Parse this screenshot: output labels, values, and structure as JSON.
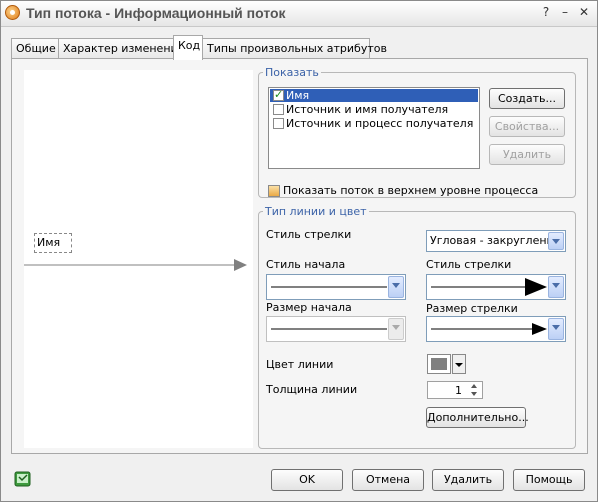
{
  "window": {
    "title": "Тип потока - Информационный поток"
  },
  "tabs": [
    {
      "label": "Общие"
    },
    {
      "label": "Характер изменения"
    },
    {
      "label": "Код"
    },
    {
      "label": "Типы произвольных атрибутов"
    }
  ],
  "preview": {
    "flow_label": "Имя"
  },
  "show_group": {
    "legend": "Показать",
    "items": [
      {
        "label": "Имя",
        "checked": true,
        "selected": true
      },
      {
        "label": "Источник и имя получателя",
        "checked": false
      },
      {
        "label": "Источник и процесс получателя",
        "checked": false
      }
    ],
    "create_button": "Создать...",
    "properties_button": "Свойства...",
    "delete_button": "Удалить",
    "show_top_label": "Показать поток в верхнем уровне процесса"
  },
  "line_group": {
    "legend": "Тип линии и цвет",
    "arrow_style_label": "Стиль стрелки",
    "arrow_style_value": "Угловая - закругленна",
    "start_style_label": "Стиль начала",
    "end_style_label": "Стиль стрелки",
    "start_size_label": "Размер начала",
    "end_size_label": "Размер стрелки",
    "line_color_label": "Цвет линии",
    "line_color": "#808080",
    "line_width_label": "Толщина линии",
    "line_width_value": "1",
    "advanced_button": "Дополнительно..."
  },
  "footer": {
    "ok": "OK",
    "cancel": "Отмена",
    "delete": "Удалить",
    "help": "Помощь"
  },
  "icons": {
    "app": "app-icon",
    "help": "help-book-icon"
  }
}
